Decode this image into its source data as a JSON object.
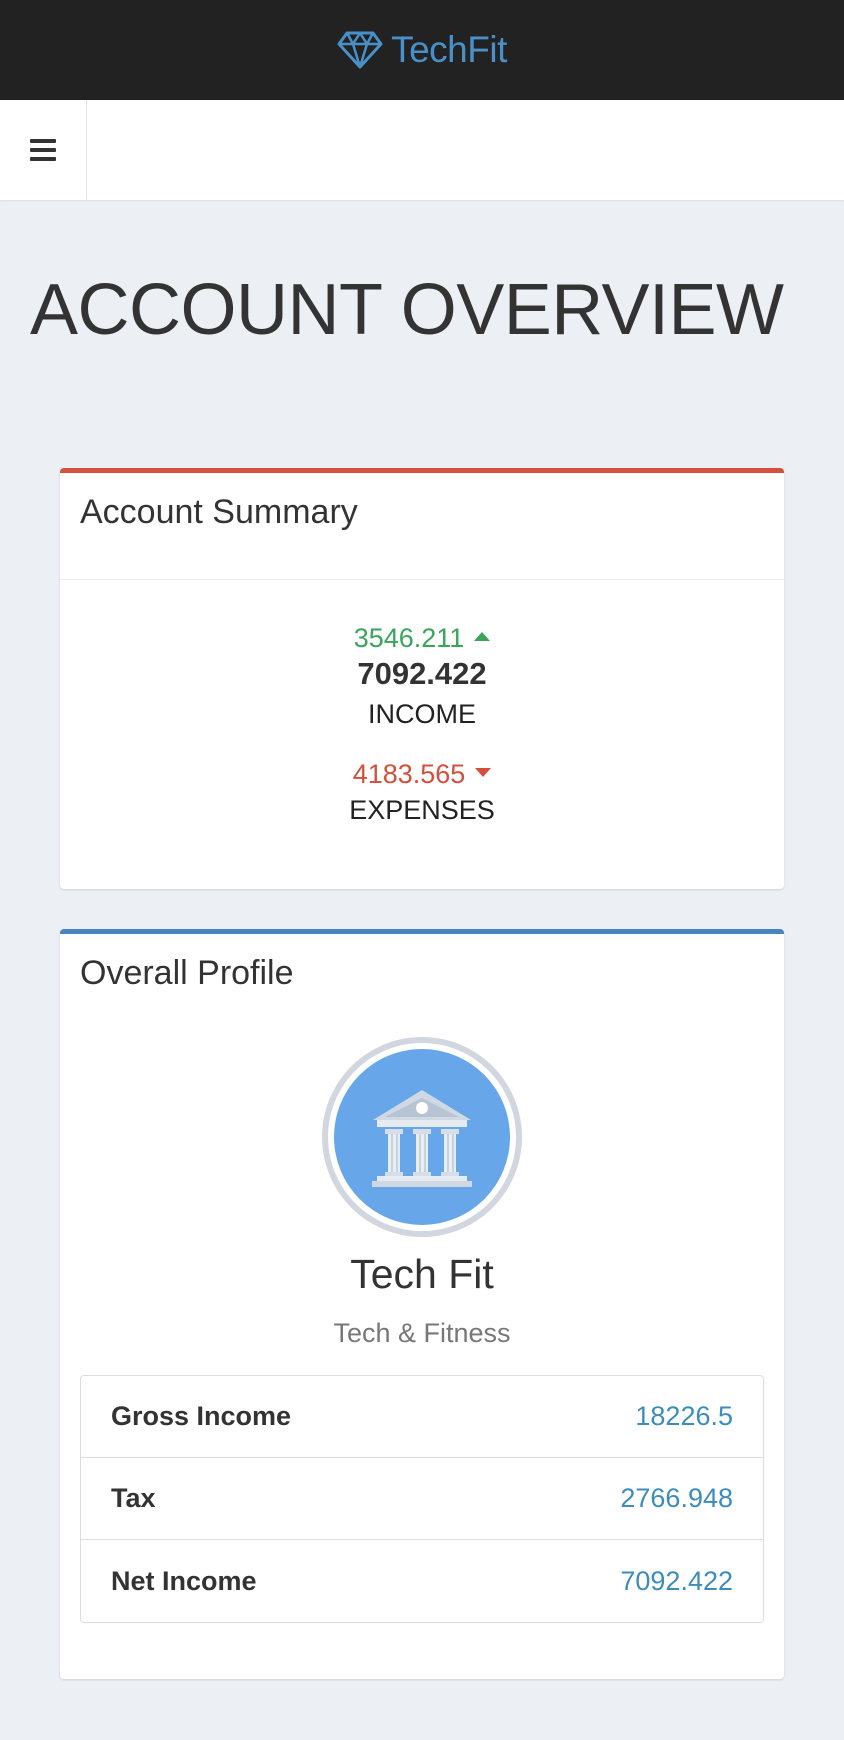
{
  "brand": {
    "name": "TechFit",
    "icon": "diamond-icon",
    "color": "#4a90c8"
  },
  "navbar": {
    "menu_icon": "hamburger-menu-icon"
  },
  "page": {
    "title": "ACCOUNT OVERVIEW"
  },
  "summary": {
    "title": "Account Summary",
    "accent_color": "#d5503c",
    "income": {
      "change": "3546.211",
      "change_direction": "up",
      "value": "7092.422",
      "label": "INCOME"
    },
    "expenses": {
      "change": "4183.565",
      "change_direction": "down",
      "label": "EXPENSES"
    },
    "colors": {
      "up": "#3aa45b",
      "down": "#d5503c"
    }
  },
  "profile": {
    "title": "Overall Profile",
    "accent_color": "#4a84bd",
    "avatar_icon": "bank-building-icon",
    "name": "Tech Fit",
    "subtitle": "Tech & Fitness",
    "stats": [
      {
        "label": "Gross Income",
        "value": "18226.5"
      },
      {
        "label": "Tax",
        "value": "2766.948"
      },
      {
        "label": "Net Income",
        "value": "7092.422"
      }
    ]
  }
}
